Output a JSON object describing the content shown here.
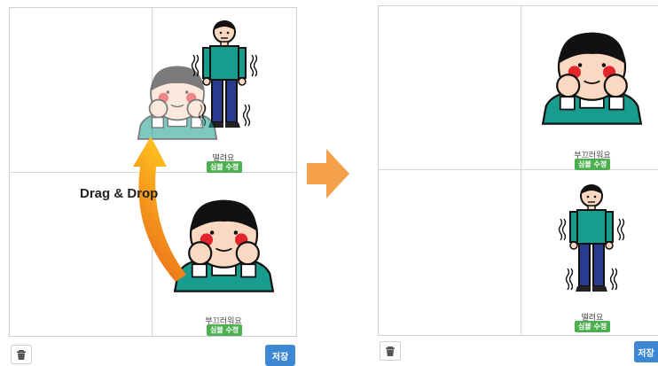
{
  "left_panel": {
    "cells": [
      {
        "label": "떨려요",
        "badge": "심볼 수정"
      },
      {
        "label": "부끄러워요",
        "badge": "심볼 수정"
      }
    ],
    "delete_icon": "trash-icon",
    "save_label": "저장"
  },
  "annotation": {
    "text": "Drag & Drop"
  },
  "right_panel": {
    "cells": [
      {
        "label": "부끄러워요",
        "badge": "심볼 수정"
      },
      {
        "label": "떨려요",
        "badge": "심볼 수정"
      }
    ],
    "delete_icon": "trash-icon",
    "save_label": "저장"
  },
  "colors": {
    "badge": "#4caf50",
    "save_button": "#3d87d4",
    "transition_arrow": "#f5a04a",
    "drag_arrow": "#f08a1c"
  }
}
